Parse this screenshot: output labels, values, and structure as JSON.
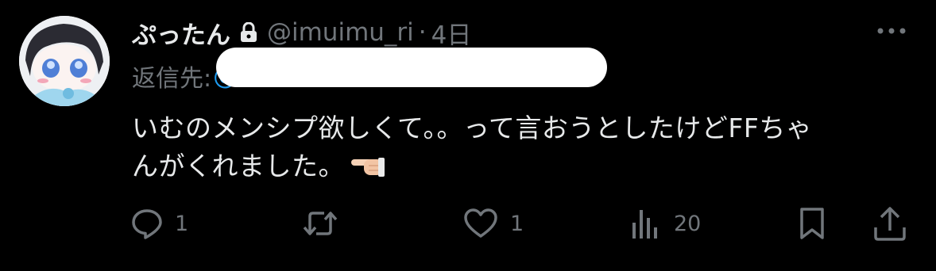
{
  "post": {
    "display_name": "ぷったん",
    "protected_icon": "lock-icon",
    "handle": "@imuimu_ri",
    "separator": "·",
    "timestamp": "4日",
    "reply_label": "返信先:",
    "reply_target": "@",
    "text_lines": [
      "いむのメンシプ欲しくて。。って言おうとしたけどFFちゃ",
      "んがくれました。"
    ],
    "emoji": "backhand-index-pointing-right"
  },
  "actions": {
    "reply": {
      "icon": "reply-icon",
      "count": "1"
    },
    "repost": {
      "icon": "repost-icon",
      "count": ""
    },
    "like": {
      "icon": "heart-icon",
      "count": "1"
    },
    "views": {
      "icon": "views-icon",
      "count": "20"
    },
    "bookmark": {
      "icon": "bookmark-icon"
    },
    "share": {
      "icon": "share-icon"
    }
  },
  "colors": {
    "background": "#000000",
    "primary_text": "#e7e9ea",
    "secondary_text": "#71767b",
    "link": "#1d9bf0",
    "redaction": "#ffffff"
  }
}
